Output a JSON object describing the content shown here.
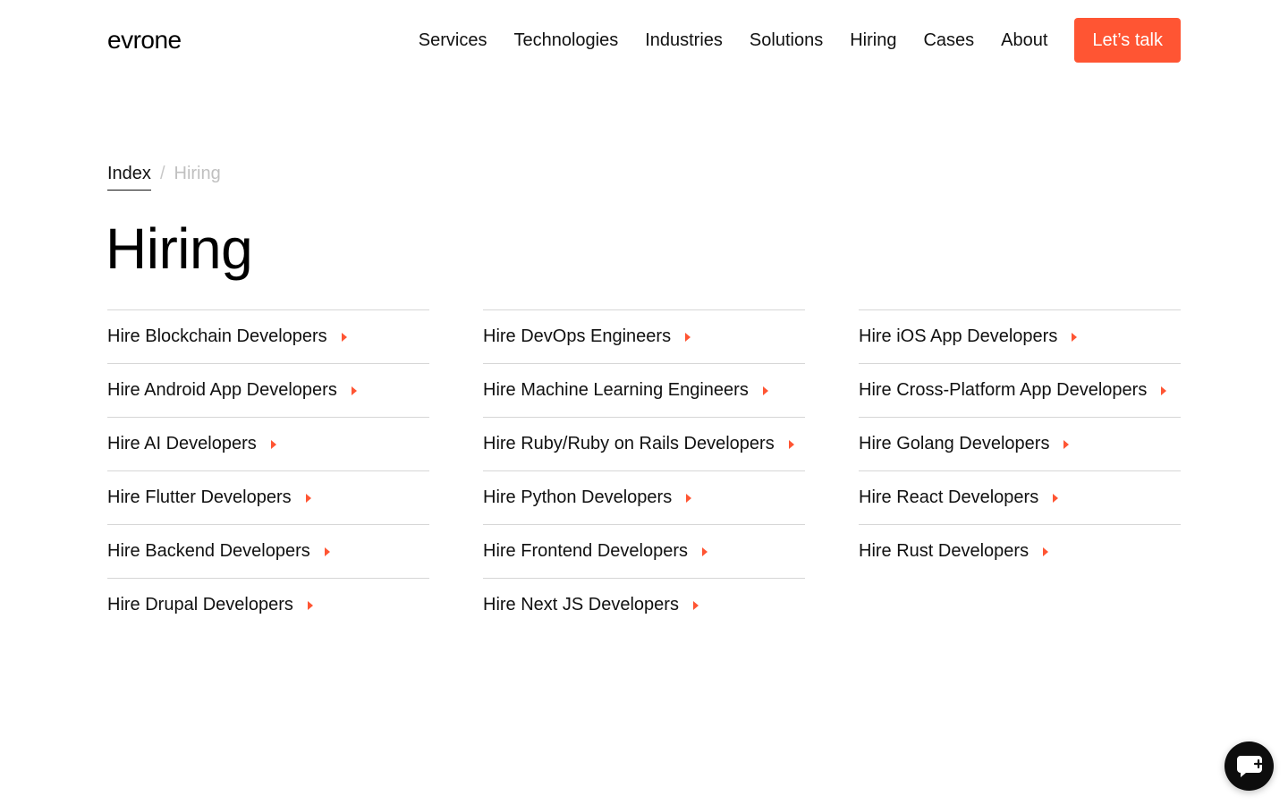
{
  "header": {
    "logo": "evrone",
    "nav": [
      "Services",
      "Technologies",
      "Industries",
      "Solutions",
      "Hiring",
      "Cases",
      "About"
    ],
    "cta_label": "Let’s talk"
  },
  "breadcrumb": {
    "root": "Index",
    "separator": "/",
    "current": "Hiring"
  },
  "page_title": "Hiring",
  "columns": [
    [
      "Hire Blockchain Developers",
      "Hire Android App Developers",
      "Hire AI Developers",
      "Hire Flutter Developers",
      "Hire Backend Developers",
      "Hire Drupal Developers"
    ],
    [
      "Hire DevOps Engineers",
      "Hire Machine Learning Engineers",
      "Hire Ruby/Ruby on Rails Developers",
      "Hire Python Developers",
      "Hire Frontend Developers",
      "Hire Next JS Developers"
    ],
    [
      "Hire iOS App Developers",
      "Hire Cross-Platform App Developers",
      "Hire Golang Developers",
      "Hire React Developers",
      "Hire Rust Developers"
    ]
  ],
  "colors": {
    "accent": "#ff5533",
    "text": "#111111",
    "muted": "#c0c0c0",
    "divider": "#d6d6d6",
    "chat_bg": "#0d0d0d"
  },
  "icons": {
    "item_arrow": "caret-right-icon",
    "chat": "chat-bubble-icon"
  }
}
